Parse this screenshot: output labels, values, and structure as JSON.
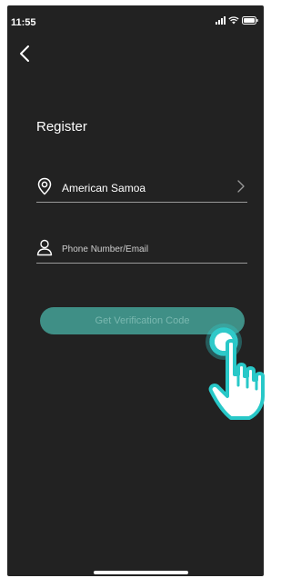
{
  "status_bar": {
    "time": "11:55",
    "signal_icon": "signal-bars-icon",
    "wifi_icon": "wifi-icon",
    "battery_icon": "battery-icon"
  },
  "nav": {
    "back_icon": "chevron-left-icon"
  },
  "register": {
    "title": "Register",
    "region": {
      "icon": "location-pin-icon",
      "value": "American Samoa",
      "chevron_icon": "chevron-right-icon"
    },
    "contact": {
      "icon": "user-icon",
      "value": "",
      "placeholder": "Phone Number/Email"
    },
    "verify_button_label": "Get Verification Code"
  },
  "overlay": {
    "hand_icon": "pointing-hand-icon",
    "tap_icon": "tap-indicator-icon"
  },
  "colors": {
    "background": "#222222",
    "button": "#3f8f86",
    "button_text": "#7ab8b0",
    "accent": "#2fc9c9"
  }
}
